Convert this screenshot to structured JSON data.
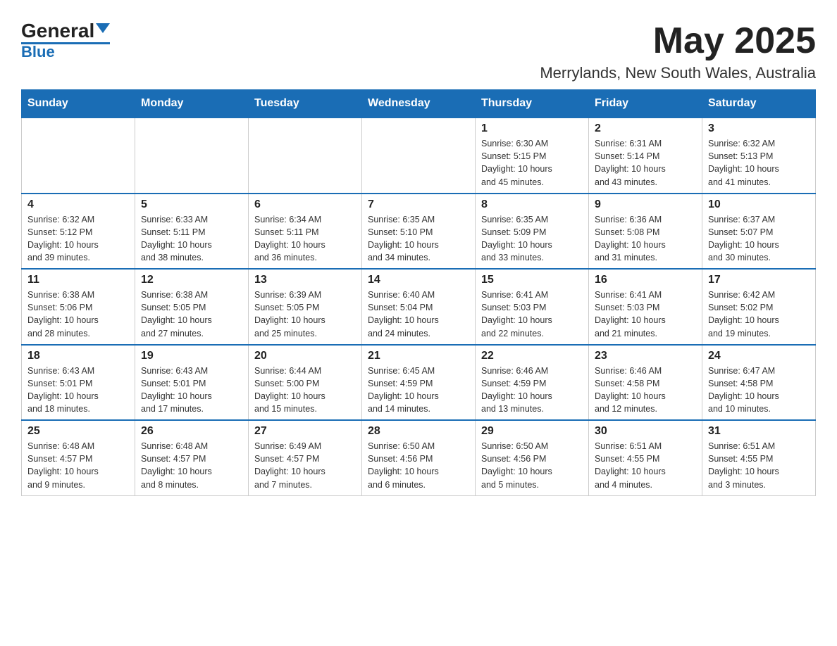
{
  "logo": {
    "text_general": "General",
    "text_blue": "Blue"
  },
  "title": {
    "month_year": "May 2025",
    "location": "Merrylands, New South Wales, Australia"
  },
  "days_of_week": [
    "Sunday",
    "Monday",
    "Tuesday",
    "Wednesday",
    "Thursday",
    "Friday",
    "Saturday"
  ],
  "weeks": [
    [
      {
        "day": "",
        "info": ""
      },
      {
        "day": "",
        "info": ""
      },
      {
        "day": "",
        "info": ""
      },
      {
        "day": "",
        "info": ""
      },
      {
        "day": "1",
        "info": "Sunrise: 6:30 AM\nSunset: 5:15 PM\nDaylight: 10 hours\nand 45 minutes."
      },
      {
        "day": "2",
        "info": "Sunrise: 6:31 AM\nSunset: 5:14 PM\nDaylight: 10 hours\nand 43 minutes."
      },
      {
        "day": "3",
        "info": "Sunrise: 6:32 AM\nSunset: 5:13 PM\nDaylight: 10 hours\nand 41 minutes."
      }
    ],
    [
      {
        "day": "4",
        "info": "Sunrise: 6:32 AM\nSunset: 5:12 PM\nDaylight: 10 hours\nand 39 minutes."
      },
      {
        "day": "5",
        "info": "Sunrise: 6:33 AM\nSunset: 5:11 PM\nDaylight: 10 hours\nand 38 minutes."
      },
      {
        "day": "6",
        "info": "Sunrise: 6:34 AM\nSunset: 5:11 PM\nDaylight: 10 hours\nand 36 minutes."
      },
      {
        "day": "7",
        "info": "Sunrise: 6:35 AM\nSunset: 5:10 PM\nDaylight: 10 hours\nand 34 minutes."
      },
      {
        "day": "8",
        "info": "Sunrise: 6:35 AM\nSunset: 5:09 PM\nDaylight: 10 hours\nand 33 minutes."
      },
      {
        "day": "9",
        "info": "Sunrise: 6:36 AM\nSunset: 5:08 PM\nDaylight: 10 hours\nand 31 minutes."
      },
      {
        "day": "10",
        "info": "Sunrise: 6:37 AM\nSunset: 5:07 PM\nDaylight: 10 hours\nand 30 minutes."
      }
    ],
    [
      {
        "day": "11",
        "info": "Sunrise: 6:38 AM\nSunset: 5:06 PM\nDaylight: 10 hours\nand 28 minutes."
      },
      {
        "day": "12",
        "info": "Sunrise: 6:38 AM\nSunset: 5:05 PM\nDaylight: 10 hours\nand 27 minutes."
      },
      {
        "day": "13",
        "info": "Sunrise: 6:39 AM\nSunset: 5:05 PM\nDaylight: 10 hours\nand 25 minutes."
      },
      {
        "day": "14",
        "info": "Sunrise: 6:40 AM\nSunset: 5:04 PM\nDaylight: 10 hours\nand 24 minutes."
      },
      {
        "day": "15",
        "info": "Sunrise: 6:41 AM\nSunset: 5:03 PM\nDaylight: 10 hours\nand 22 minutes."
      },
      {
        "day": "16",
        "info": "Sunrise: 6:41 AM\nSunset: 5:03 PM\nDaylight: 10 hours\nand 21 minutes."
      },
      {
        "day": "17",
        "info": "Sunrise: 6:42 AM\nSunset: 5:02 PM\nDaylight: 10 hours\nand 19 minutes."
      }
    ],
    [
      {
        "day": "18",
        "info": "Sunrise: 6:43 AM\nSunset: 5:01 PM\nDaylight: 10 hours\nand 18 minutes."
      },
      {
        "day": "19",
        "info": "Sunrise: 6:43 AM\nSunset: 5:01 PM\nDaylight: 10 hours\nand 17 minutes."
      },
      {
        "day": "20",
        "info": "Sunrise: 6:44 AM\nSunset: 5:00 PM\nDaylight: 10 hours\nand 15 minutes."
      },
      {
        "day": "21",
        "info": "Sunrise: 6:45 AM\nSunset: 4:59 PM\nDaylight: 10 hours\nand 14 minutes."
      },
      {
        "day": "22",
        "info": "Sunrise: 6:46 AM\nSunset: 4:59 PM\nDaylight: 10 hours\nand 13 minutes."
      },
      {
        "day": "23",
        "info": "Sunrise: 6:46 AM\nSunset: 4:58 PM\nDaylight: 10 hours\nand 12 minutes."
      },
      {
        "day": "24",
        "info": "Sunrise: 6:47 AM\nSunset: 4:58 PM\nDaylight: 10 hours\nand 10 minutes."
      }
    ],
    [
      {
        "day": "25",
        "info": "Sunrise: 6:48 AM\nSunset: 4:57 PM\nDaylight: 10 hours\nand 9 minutes."
      },
      {
        "day": "26",
        "info": "Sunrise: 6:48 AM\nSunset: 4:57 PM\nDaylight: 10 hours\nand 8 minutes."
      },
      {
        "day": "27",
        "info": "Sunrise: 6:49 AM\nSunset: 4:57 PM\nDaylight: 10 hours\nand 7 minutes."
      },
      {
        "day": "28",
        "info": "Sunrise: 6:50 AM\nSunset: 4:56 PM\nDaylight: 10 hours\nand 6 minutes."
      },
      {
        "day": "29",
        "info": "Sunrise: 6:50 AM\nSunset: 4:56 PM\nDaylight: 10 hours\nand 5 minutes."
      },
      {
        "day": "30",
        "info": "Sunrise: 6:51 AM\nSunset: 4:55 PM\nDaylight: 10 hours\nand 4 minutes."
      },
      {
        "day": "31",
        "info": "Sunrise: 6:51 AM\nSunset: 4:55 PM\nDaylight: 10 hours\nand 3 minutes."
      }
    ]
  ]
}
